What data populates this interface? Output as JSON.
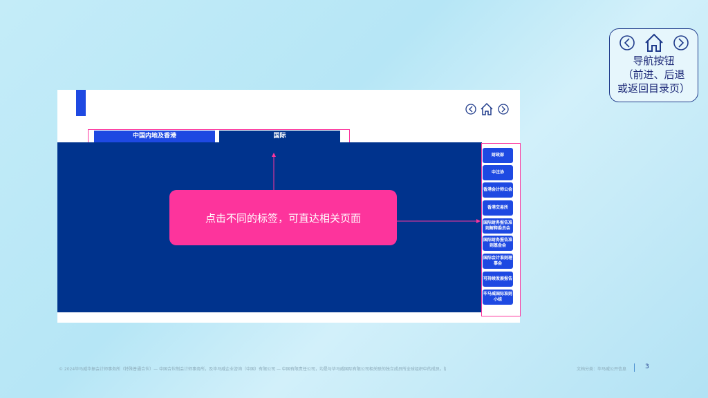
{
  "nav_help": {
    "line1": "导航按钮",
    "line2": "（前进、后退",
    "line3": "或返回目录页）"
  },
  "tabs": [
    {
      "label": "中国内地及香港",
      "color": "#1e49e2"
    },
    {
      "label": "国际",
      "color": "#00338d"
    }
  ],
  "side_buttons": [
    "财政部",
    "中注协",
    "香港会计师公会",
    "香港交易所",
    "国际财务报告准则解释委员会",
    "国际财务报告准则基金会",
    "国际会计准则理事会",
    "可持续发展报告",
    "毕马威国际准则小组"
  ],
  "callout": "点击不同的标签，可直达相关页面",
  "footer": {
    "copyright": "© 2024毕马威华振会计师事务所（特殊普通合伙）— 中国合伙制会计师事务所，及毕马威企业咨询（中国）有限公司 — 中国有限责任公司，均是与毕马威国际有限公司相关联的独立成员所全球组织中的成员。版权所有，不得转载。",
    "classification": "文档分类：毕马威公开信息",
    "page": "3"
  },
  "colors": {
    "brand_blue": "#00338d",
    "accent_blue": "#1e49e2",
    "pink": "#fd349c"
  }
}
